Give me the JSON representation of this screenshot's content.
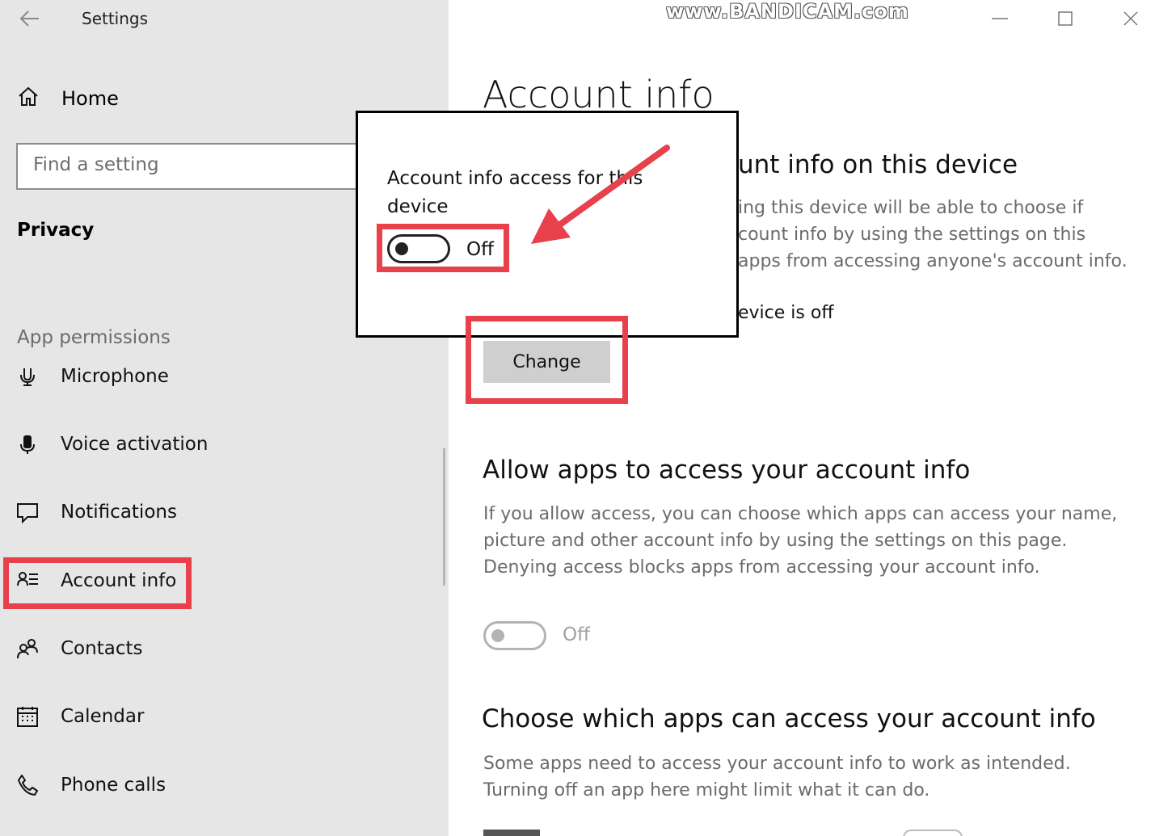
{
  "window": {
    "title": "Settings",
    "watermark": "www.BANDICAM.com"
  },
  "sidebar": {
    "home_label": "Home",
    "search_placeholder": "Find a setting",
    "section": "Privacy",
    "group_label": "App permissions",
    "items": [
      {
        "label": "Microphone",
        "icon": "microphone-icon"
      },
      {
        "label": "Voice activation",
        "icon": "voice-activation-icon"
      },
      {
        "label": "Notifications",
        "icon": "notifications-icon"
      },
      {
        "label": "Account info",
        "icon": "account-info-icon",
        "selected": true
      },
      {
        "label": "Contacts",
        "icon": "contacts-icon"
      },
      {
        "label": "Calendar",
        "icon": "calendar-icon"
      },
      {
        "label": "Phone calls",
        "icon": "phone-icon"
      }
    ]
  },
  "main": {
    "page_title": "Account info",
    "device_section": {
      "heading_visible": "unt info on this device",
      "desc_lines": [
        "ing this device will be able to choose if",
        "count info by using the settings on this",
        "apps from accessing anyone's account info."
      ],
      "status_visible": "evice is off",
      "change_button": "Change"
    },
    "allow_section": {
      "heading": "Allow apps to access your account info",
      "desc_lines": [
        "If you allow access, you can choose which apps can access your name,",
        "picture and other account info by using the settings on this page.",
        "Denying access blocks apps from accessing your account info."
      ],
      "toggle_label": "Off",
      "toggle_state": false
    },
    "choose_section": {
      "heading": "Choose which apps can access your account info",
      "desc_lines": [
        "Some apps need to access your account info to work as intended.",
        "Turning off an app here might limit what it can do."
      ]
    }
  },
  "popup": {
    "title": "Account info access for this device",
    "toggle_label": "Off",
    "toggle_state": false
  },
  "annotation": {
    "color": "#e8414c"
  }
}
